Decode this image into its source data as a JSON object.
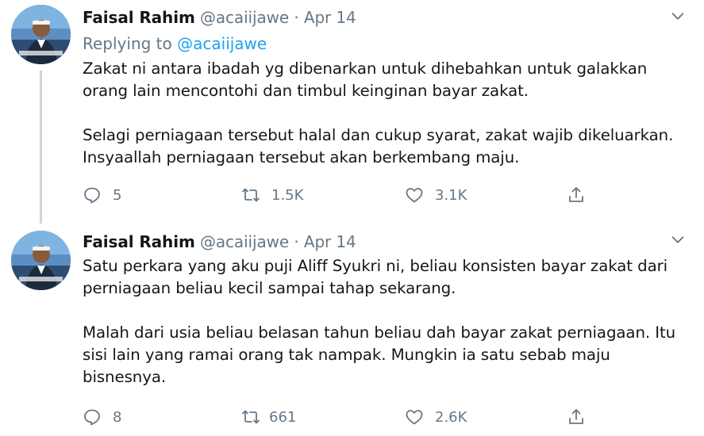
{
  "tweets": [
    {
      "name": "Faisal Rahim",
      "handle": "@acaiijawe",
      "separator": "·",
      "date": "Apr 14",
      "replying_prefix": "Replying to",
      "replying_to": "@acaiijawe",
      "paragraphs": [
        "Zakat ni antara ibadah yg dibenarkan untuk dihebahkan untuk galakkan\norang lain mencontohi dan timbul keinginan bayar zakat.",
        "Selagi perniagaan tersebut halal dan cukup syarat, zakat wajib dikeluarkan.\nInsyaallah perniagaan tersebut akan berkembang maju."
      ],
      "replies": "5",
      "retweets": "1.5K",
      "likes": "3.1K"
    },
    {
      "name": "Faisal Rahim",
      "handle": "@acaiijawe",
      "separator": "·",
      "date": "Apr 14",
      "paragraphs": [
        "Satu perkara yang aku puji Aliff Syukri ni, beliau konsisten bayar zakat dari\nperniagaan beliau kecil sampai tahap sekarang.",
        "Malah dari usia beliau belasan tahun beliau dah bayar zakat perniagaan. Itu\nsisi lain yang ramai orang tak nampak. Mungkin ia satu sebab maju\nbisnesnya."
      ],
      "replies": "8",
      "retweets": "661",
      "likes": "2.6K"
    }
  ],
  "colors": {
    "text": "#14171a",
    "secondary": "#657786",
    "link": "#1da1f2",
    "thread_line": "#ccd6dd"
  },
  "icons": [
    "avatar",
    "chevron-down-icon",
    "reply-icon",
    "retweet-icon",
    "like-icon",
    "share-icon"
  ]
}
